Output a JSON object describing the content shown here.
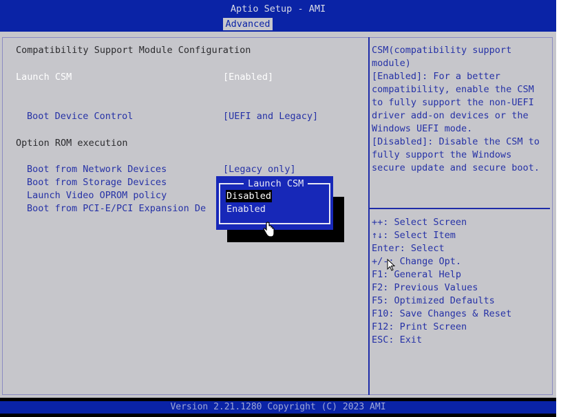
{
  "header": {
    "title": "Aptio Setup - AMI",
    "active_tab": "Advanced"
  },
  "left_panel": {
    "section_title": "Compatibility Support Module Configuration",
    "launch_csm": {
      "label": "Launch CSM",
      "value": "[Enabled]"
    },
    "boot_device_control": {
      "label": "Boot Device Control",
      "value": "[UEFI and Legacy]"
    },
    "option_rom_title": "Option ROM execution",
    "boot_network": {
      "label": "Boot from Network Devices",
      "value": "[Legacy only]"
    },
    "boot_storage": {
      "label": "Boot from Storage Devices"
    },
    "launch_video": {
      "label": "Launch Video OPROM policy"
    },
    "boot_pcie": {
      "label": "Boot from PCI-E/PCI Expansion De"
    }
  },
  "popup": {
    "title": "Launch CSM",
    "options": [
      "Disabled",
      "Enabled"
    ],
    "selected": "Disabled"
  },
  "help_text": [
    "CSM(compatibility support",
    "module)",
    "[Enabled]: For a better",
    "compatibility, enable the CSM",
    "to fully support the non-UEFI",
    "driver add-on devices or the",
    "Windows UEFI mode.",
    "[Disabled]: Disable the CSM to",
    "fully support the Windows",
    "secure update and secure boot."
  ],
  "key_help": [
    "++: Select Screen",
    "↑↓: Select Item",
    "Enter: Select",
    "+/-: Change Opt.",
    "F1: General Help",
    "F2: Previous Values",
    "F5: Optimized Defaults",
    "F10: Save Changes & Reset",
    "F12: Print Screen",
    "ESC: Exit"
  ],
  "footer": "Version 2.21.1280 Copyright (C) 2023 AMI",
  "colors": {
    "bios_blue": "#0a23a6",
    "panel_gray": "#c6c6cb",
    "highlight_text": "#ffffff",
    "option_text": "#2531a6"
  }
}
